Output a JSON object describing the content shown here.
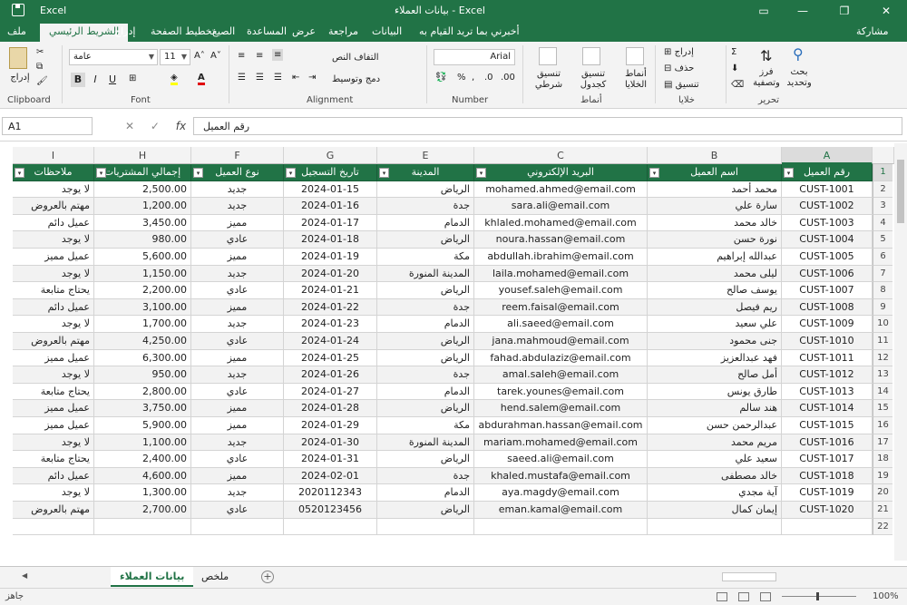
{
  "window": {
    "app_name": "Excel",
    "doc_title": "بيانات العملاء - Excel",
    "min": "—",
    "restore": "❐",
    "close": "✕",
    "ribbon_display": "▭"
  },
  "tabs": {
    "file": "ملف",
    "home": "الشريط الرئيسي",
    "insert": "إدراج",
    "draw": "تخطيط الصفحة",
    "layout": "الصيغ",
    "formulas": "الصيغ",
    "data": "البيانات",
    "review": "مراجعة",
    "view": "عرض",
    "help": "المساعدة",
    "tell_me": "أخبرني بما تريد القيام به",
    "share": "مشاركة"
  },
  "ribbon": {
    "clipboard": {
      "label": "Clipboard",
      "paste": "إدراج"
    },
    "font": {
      "label": "Font",
      "name": "عامة",
      "size": "11",
      "bold": "B",
      "italic": "I",
      "underline": "U"
    },
    "alignment": {
      "label": "Alignment",
      "wrap": "التفاف النص",
      "merge": "دمج وتوسيط"
    },
    "number": {
      "label": "Number",
      "format": "Arial"
    },
    "styles": {
      "label": "أنماط",
      "conditional": "تنسيق شرطي",
      "as_table": "تنسيق كجدول",
      "cell_styles": "أنماط الخلايا"
    },
    "cells": {
      "label": "خلايا",
      "insert": "إدراج",
      "delete": "حذف",
      "format": "تنسيق"
    },
    "editing": {
      "label": "تحرير",
      "sort": "فرز وتصفية",
      "find": "بحث وتحديد"
    }
  },
  "formula_bar": {
    "name_box": "A1",
    "content": "رقم العميل",
    "cancel": "✕",
    "enter": "✓",
    "fx": "fx"
  },
  "columns": [
    "A",
    "B",
    "C",
    "E",
    "G",
    "F",
    "H",
    "I"
  ],
  "headers": [
    "رقم العميل",
    "اسم العميل",
    "البريد الإلكتروني",
    "المدينة",
    "تاريخ التسجيل",
    "نوع العميل",
    "إجمالي المشتريات",
    "ملاحظات"
  ],
  "rows": [
    [
      "CUST-1001",
      "محمد أحمد",
      "mohamed.ahmed@email.com",
      "الرياض",
      "2024-01-15",
      "جديد",
      "2,500.00",
      "لا يوجد"
    ],
    [
      "CUST-1002",
      "سارة علي",
      "sara.ali@email.com",
      "جدة",
      "2024-01-16",
      "جديد",
      "1,200.00",
      "مهتم بالعروض"
    ],
    [
      "CUST-1003",
      "خالد محمد",
      "khlaled.mohamed@email.com",
      "الدمام",
      "2024-01-17",
      "مميز",
      "3,450.00",
      "عميل دائم"
    ],
    [
      "CUST-1004",
      "نورة حسن",
      "noura.hassan@email.com",
      "الرياض",
      "2024-01-18",
      "عادي",
      "980.00",
      "لا يوجد"
    ],
    [
      "CUST-1005",
      "عبدالله إبراهيم",
      "abdullah.ibrahim@email.com",
      "مكة",
      "2024-01-19",
      "مميز",
      "5,600.00",
      "عميل مميز"
    ],
    [
      "CUST-1006",
      "ليلى محمد",
      "laila.mohamed@email.com",
      "المدينة المنورة",
      "2024-01-20",
      "جديد",
      "1,150.00",
      "لا يوجد"
    ],
    [
      "CUST-1007",
      "يوسف صالح",
      "yousef.saleh@email.com",
      "الرياض",
      "2024-01-21",
      "عادي",
      "2,200.00",
      "يحتاج متابعة"
    ],
    [
      "CUST-1008",
      "ريم فيصل",
      "reem.faisal@email.com",
      "جدة",
      "2024-01-22",
      "مميز",
      "3,100.00",
      "عميل دائم"
    ],
    [
      "CUST-1009",
      "علي سعيد",
      "ali.saeed@email.com",
      "الدمام",
      "2024-01-23",
      "جديد",
      "1,700.00",
      "لا يوجد"
    ],
    [
      "CUST-1010",
      "جنى محمود",
      "jana.mahmoud@email.com",
      "الرياض",
      "2024-01-24",
      "عادي",
      "4,250.00",
      "مهتم بالعروض"
    ],
    [
      "CUST-1011",
      "فهد عبدالعزيز",
      "fahad.abdulaziz@email.com",
      "الرياض",
      "2024-01-25",
      "مميز",
      "6,300.00",
      "عميل مميز"
    ],
    [
      "CUST-1012",
      "أمل صالح",
      "amal.saleh@email.com",
      "جدة",
      "2024-01-26",
      "جديد",
      "950.00",
      "لا يوجد"
    ],
    [
      "CUST-1013",
      "طارق يونس",
      "tarek.younes@email.com",
      "الدمام",
      "2024-01-27",
      "عادي",
      "2,800.00",
      "يحتاج متابعة"
    ],
    [
      "CUST-1014",
      "هند سالم",
      "hend.salem@email.com",
      "الرياض",
      "2024-01-28",
      "مميز",
      "3,750.00",
      "عميل مميز"
    ],
    [
      "CUST-1015",
      "عبدالرحمن حسن",
      "abdurahman.hassan@email.com",
      "مكة",
      "2024-01-29",
      "مميز",
      "5,900.00",
      "عميل مميز"
    ],
    [
      "CUST-1016",
      "مريم محمد",
      "mariam.mohamed@email.com",
      "المدينة المنورة",
      "2024-01-30",
      "جديد",
      "1,100.00",
      "لا يوجد"
    ],
    [
      "CUST-1017",
      "سعيد علي",
      "saeed.ali@email.com",
      "الرياض",
      "2024-01-31",
      "عادي",
      "2,400.00",
      "يحتاج متابعة"
    ],
    [
      "CUST-1018",
      "خالد مصطفى",
      "khaled.mustafa@email.com",
      "جدة",
      "2024-02-01",
      "مميز",
      "4,600.00",
      "عميل دائم"
    ],
    [
      "CUST-1019",
      "آية مجدي",
      "aya.magdy@email.com",
      "الدمام",
      "2020112343",
      "جديد",
      "1,300.00",
      "لا يوجد"
    ],
    [
      "CUST-1020",
      "إيمان كمال",
      "eman.kamal@email.com",
      "الرياض",
      "0520123456",
      "عادي",
      "2,700.00",
      "مهتم بالعروض"
    ]
  ],
  "sheets": {
    "active": "بيانات العملاء",
    "other": "ملخص",
    "add": "+"
  },
  "status": {
    "ready": "جاهز",
    "zoom": "100%"
  },
  "colors": {
    "accent": "#217346"
  }
}
